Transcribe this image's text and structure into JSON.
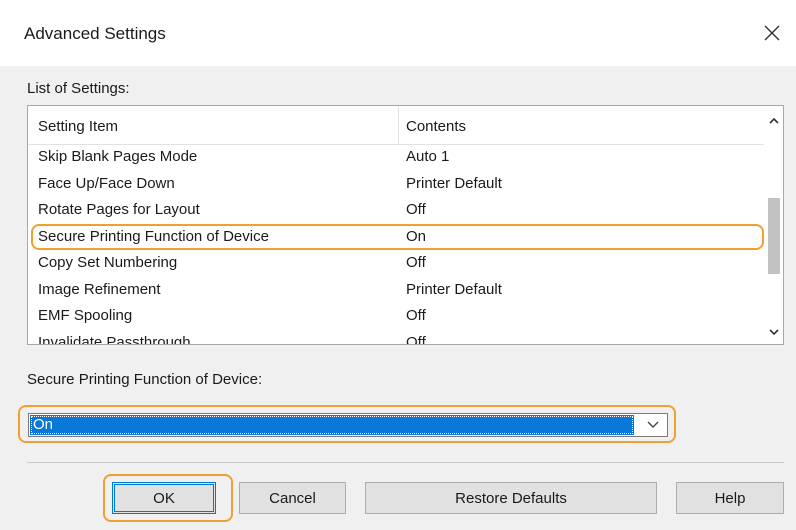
{
  "window": {
    "title": "Advanced Settings",
    "close_icon": "close-icon"
  },
  "settings_list": {
    "label": "List of Settings:",
    "columns": [
      "Setting Item",
      "Contents"
    ],
    "rows": [
      {
        "item": "Skip Blank Pages Mode",
        "content": "Auto 1"
      },
      {
        "item": "Face Up/Face Down",
        "content": "Printer Default"
      },
      {
        "item": "Rotate Pages for Layout",
        "content": "Off"
      },
      {
        "item": "Secure Printing Function of Device",
        "content": "On",
        "highlighted": true
      },
      {
        "item": "Copy Set Numbering",
        "content": "Off"
      },
      {
        "item": "Image Refinement",
        "content": "Printer Default"
      },
      {
        "item": "EMF Spooling",
        "content": "Off"
      },
      {
        "item": "Invalidate Passthrough",
        "content": "Off"
      }
    ]
  },
  "selected_setting": {
    "label": "Secure Printing Function of Device:",
    "value": "On"
  },
  "buttons": {
    "ok": "OK",
    "cancel": "Cancel",
    "restore": "Restore Defaults",
    "help": "Help"
  },
  "colors": {
    "highlight_outline": "#f0a030",
    "selection_blue": "#0a78d8",
    "dialog_bg": "#f0f0f0"
  }
}
